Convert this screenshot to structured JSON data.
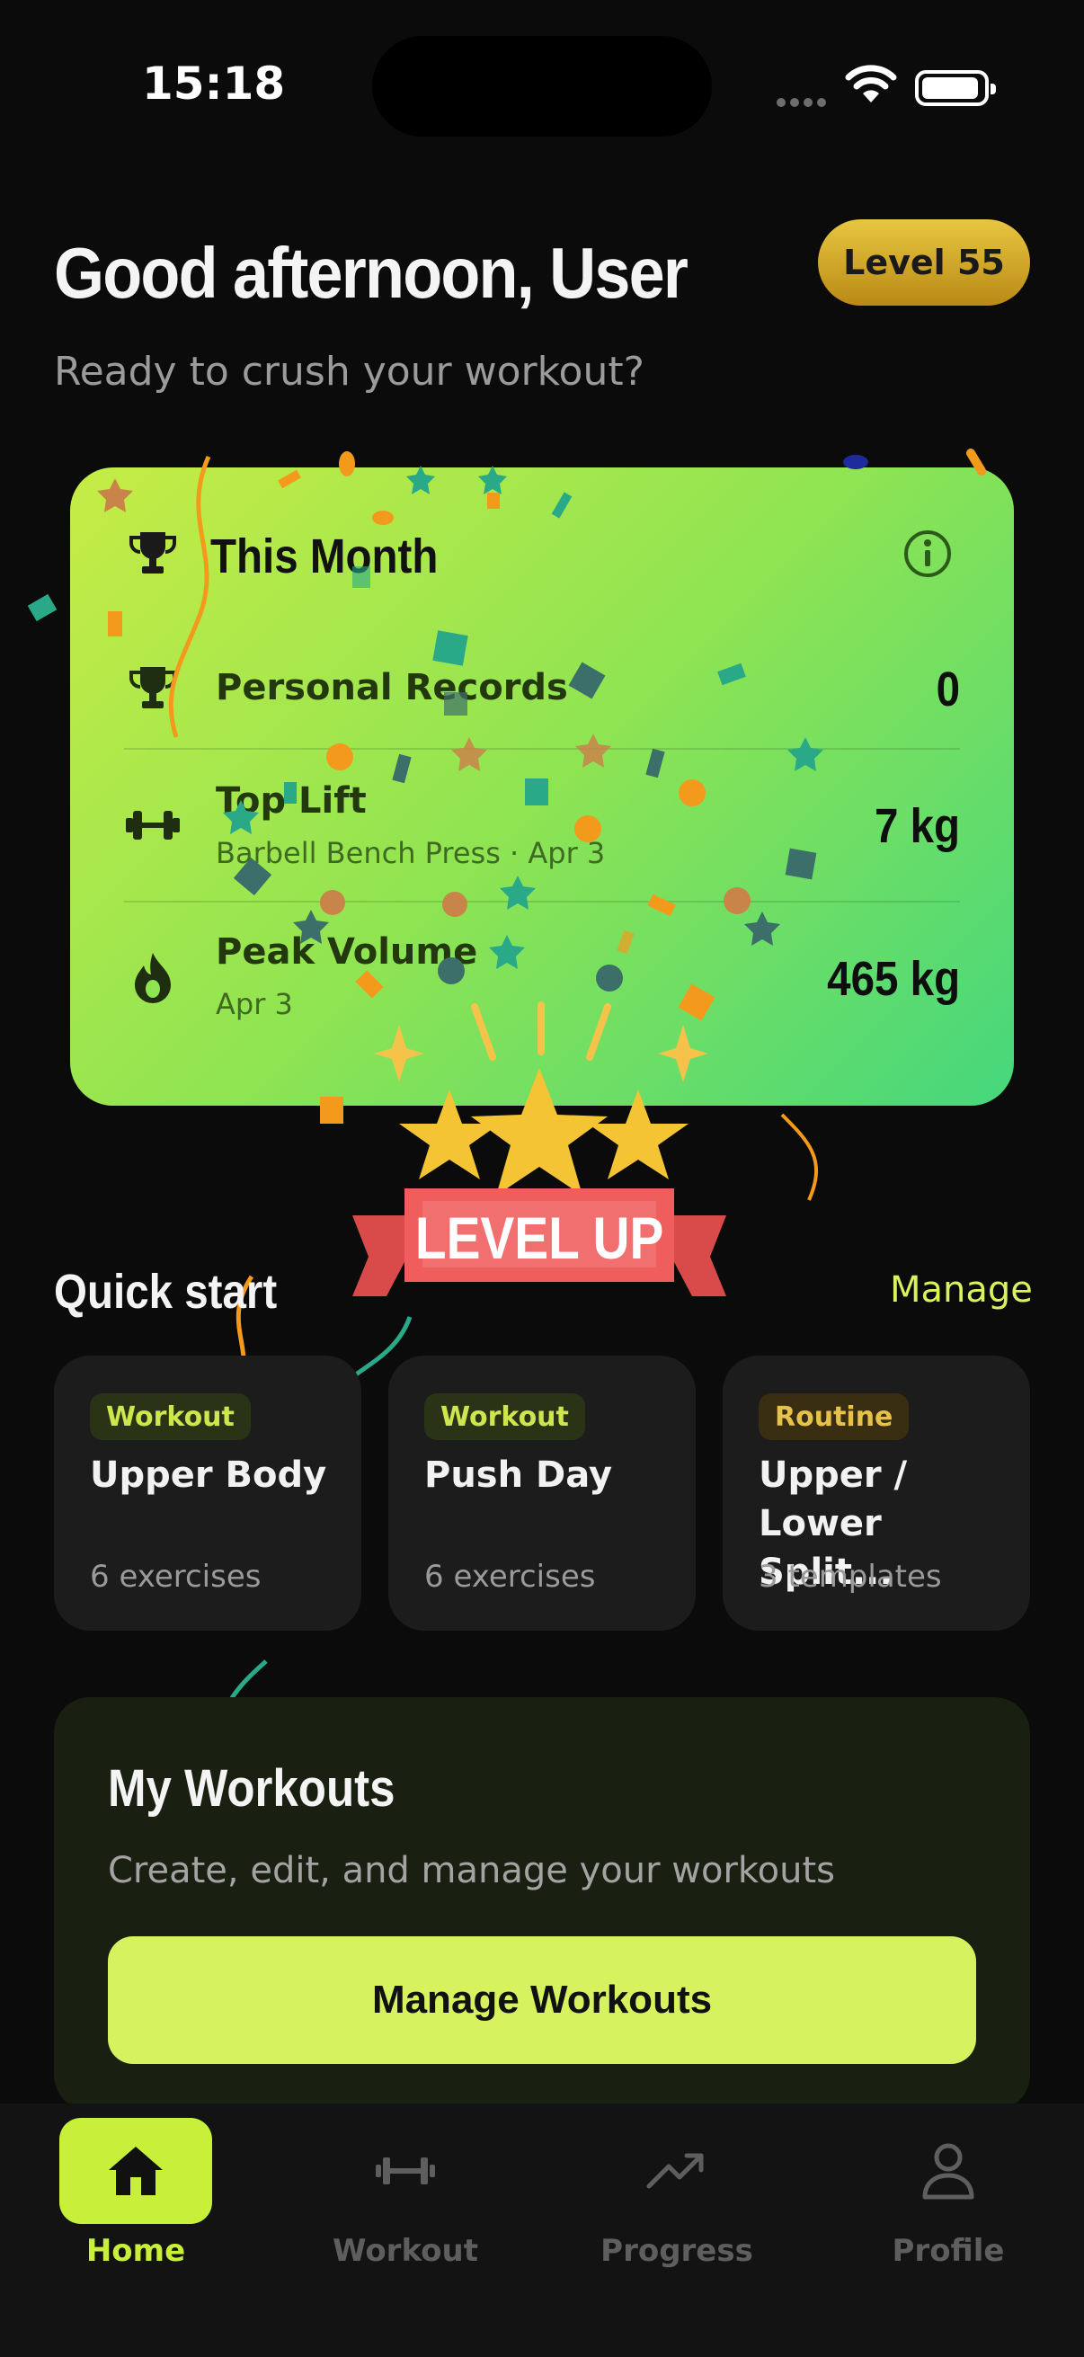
{
  "status_bar": {
    "time": "15:18"
  },
  "header": {
    "greeting": "Good afternoon, User",
    "subtitle": "Ready to crush your workout?",
    "level_badge": "Level 55"
  },
  "month_card": {
    "title": "This Month",
    "rows": [
      {
        "label": "Personal Records",
        "sub": "",
        "value": "0",
        "icon": "trophy-icon"
      },
      {
        "label": "Top Lift",
        "sub": "Barbell Bench Press · Apr 3",
        "value": "7 kg",
        "icon": "dumbbell-icon"
      },
      {
        "label": "Peak Volume",
        "sub": "Apr 3",
        "value": "465 kg",
        "icon": "flame-icon"
      }
    ]
  },
  "overlay": {
    "text": "LEVEL UP"
  },
  "quick_start": {
    "title": "Quick start",
    "manage": "Manage",
    "cards": [
      {
        "tag": "Workout",
        "name": "Upper Body",
        "meta": "6 exercises"
      },
      {
        "tag": "Workout",
        "name": "Push Day",
        "meta": "6 exercises"
      },
      {
        "tag": "Routine",
        "name": "Upper / Lower Split...",
        "meta": "3 templates"
      }
    ]
  },
  "my_workouts": {
    "title": "My Workouts",
    "subtitle": "Create, edit, and manage your workouts",
    "button": "Manage Workouts"
  },
  "nav": {
    "items": [
      {
        "label": "Home",
        "icon": "home-icon",
        "active": true
      },
      {
        "label": "Workout",
        "icon": "dumbbell-icon",
        "active": false
      },
      {
        "label": "Progress",
        "icon": "trend-icon",
        "active": false
      },
      {
        "label": "Profile",
        "icon": "person-icon",
        "active": false
      }
    ]
  },
  "colors": {
    "accent": "#d7f25f",
    "background": "#0b0b0b",
    "card": "#1c1c1c"
  }
}
